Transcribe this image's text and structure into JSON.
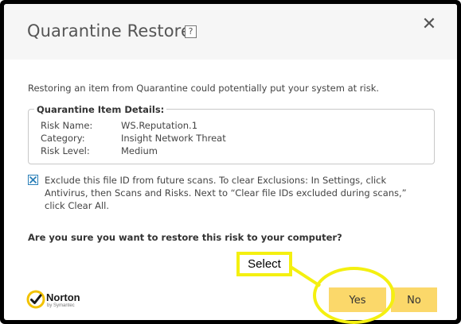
{
  "dialog": {
    "title": "Quarantine Restore",
    "help_label": "?",
    "close_label": "✕",
    "warning": "Restoring an item from Quarantine could potentially put your system at risk.",
    "details": {
      "legend": "Quarantine Item Details:",
      "rows": [
        {
          "key": "Risk Name:",
          "value": "WS.Reputation.1"
        },
        {
          "key": "Category:",
          "value": "Insight Network Threat"
        },
        {
          "key": "Risk Level:",
          "value": "Medium"
        }
      ]
    },
    "exclude_checkbox": {
      "checked": true,
      "label": "Exclude this file ID from future scans. To clear Exclusions: In Settings, click Antivirus, then Scans and Risks. Next to “Clear file IDs excluded during scans,” click Clear All."
    },
    "question": "Are you sure you want to restore this risk to your computer?",
    "buttons": {
      "yes": "Yes",
      "no": "No"
    },
    "logo": {
      "name": "Norton",
      "sub": "by Symantec"
    }
  },
  "annotation": {
    "label": "Select",
    "color": "#f4f010"
  },
  "colors": {
    "button": "#fbd86a",
    "header": "#f6f6f6",
    "checkbox": "#2a7fb8"
  }
}
